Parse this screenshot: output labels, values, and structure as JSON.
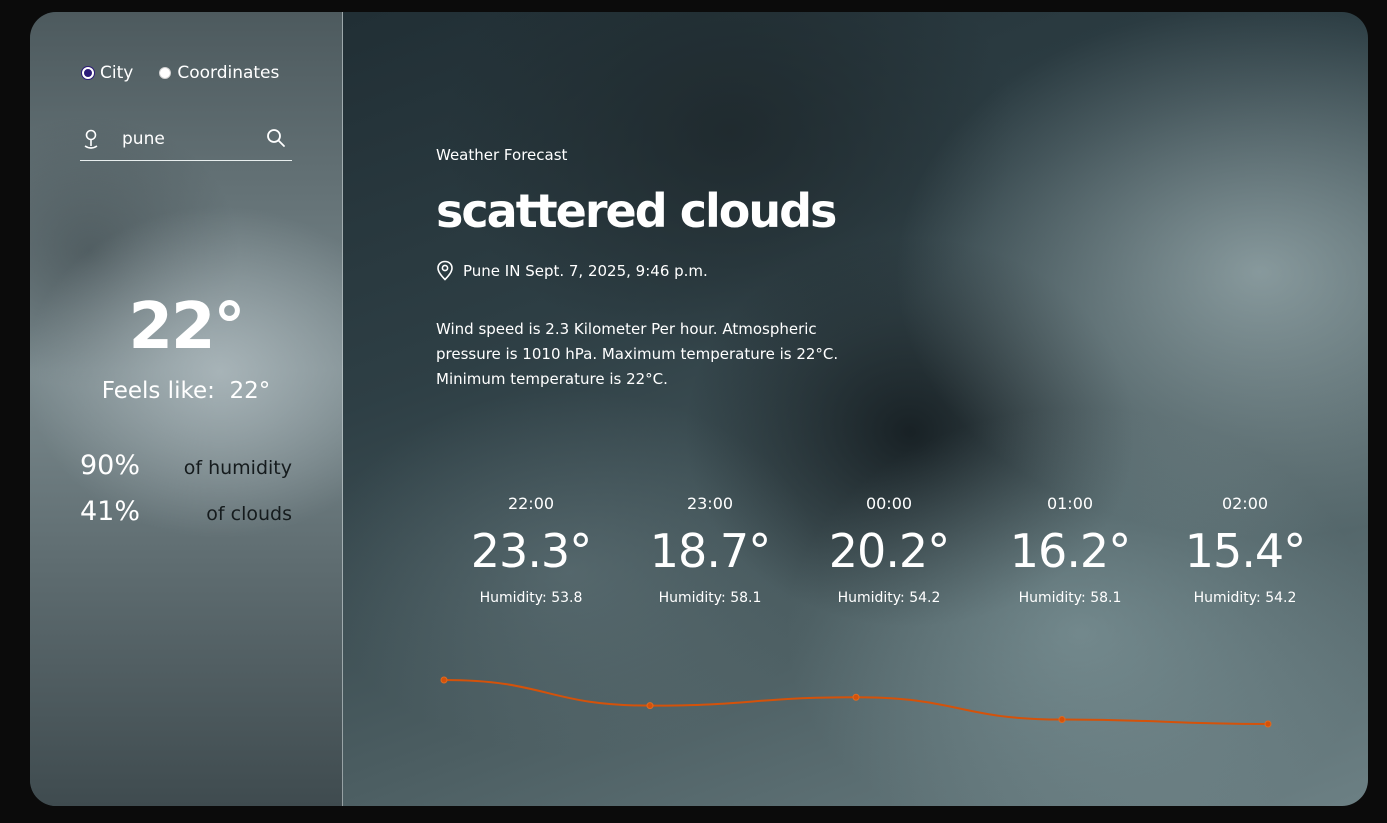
{
  "sidebar": {
    "search_mode": {
      "options": [
        "City",
        "Coordinates"
      ],
      "selected": "City"
    },
    "search": {
      "value": "pune",
      "icon_left": "location-pin-icon",
      "icon_right": "search-icon"
    },
    "current_temp": "22°",
    "feels_like_label": "Feels like:",
    "feels_like_value": "22°",
    "humidity": {
      "value": "90%",
      "label": "of humidity"
    },
    "clouds": {
      "value": "41%",
      "label": "of clouds"
    }
  },
  "main": {
    "section_label": "Weather Forecast",
    "condition": "scattered clouds",
    "location_icon": "map-pin-icon",
    "location_line": "Pune IN Sept. 7, 2025, 9:46 p.m.",
    "description": "Wind speed is 2.3 Kilometer Per hour. Atmospheric pressure is 1010 hPa. Maximum temperature is 22°C. Minimum temperature is 22°C.",
    "hourly": [
      {
        "time": "22:00",
        "temp": "23.3°",
        "humidity": "Humidity: 53.8"
      },
      {
        "time": "23:00",
        "temp": "18.7°",
        "humidity": "Humidity: 58.1"
      },
      {
        "time": "00:00",
        "temp": "20.2°",
        "humidity": "Humidity: 54.2"
      },
      {
        "time": "01:00",
        "temp": "16.2°",
        "humidity": "Humidity: 58.1"
      },
      {
        "time": "02:00",
        "temp": "15.4°",
        "humidity": "Humidity: 54.2"
      }
    ]
  },
  "chart_data": {
    "type": "line",
    "categories": [
      "22:00",
      "23:00",
      "00:00",
      "01:00",
      "02:00"
    ],
    "values": [
      23.3,
      18.7,
      20.2,
      16.2,
      15.4
    ],
    "title": "",
    "xlabel": "",
    "ylabel": "",
    "color": "#d4520a",
    "grid": false
  },
  "colors": {
    "line": "#d4520a",
    "radio_selected": "#2c1a7a",
    "text": "#ffffff"
  }
}
